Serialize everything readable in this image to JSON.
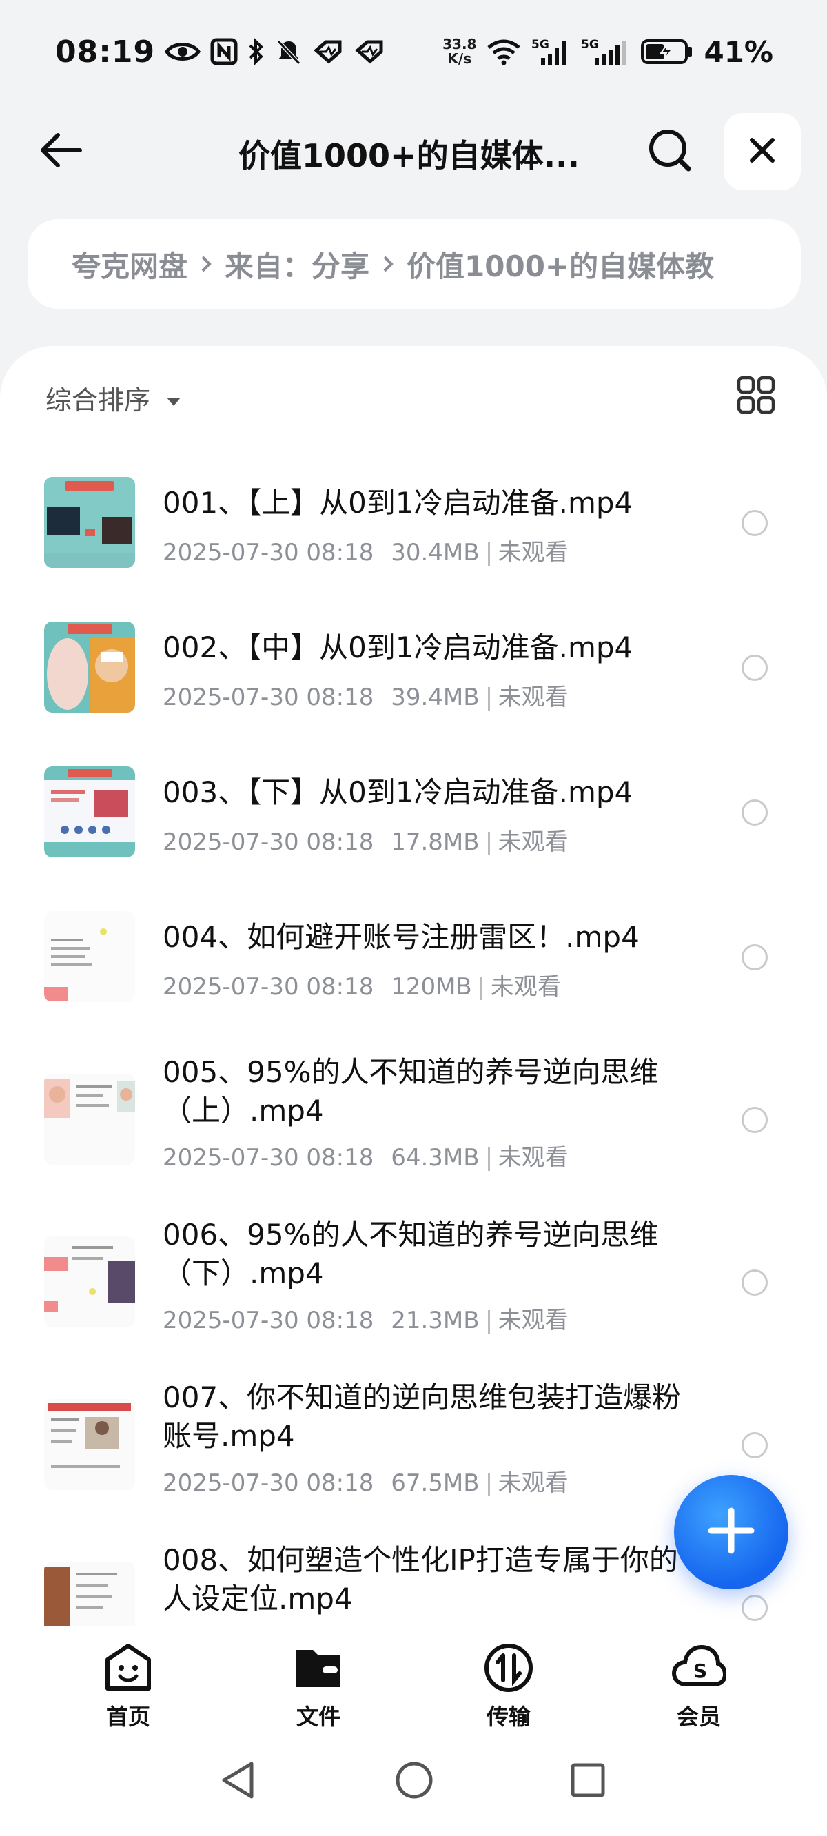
{
  "status_bar": {
    "time": "08:19",
    "net_speed_value": "33.8",
    "net_speed_unit": "K/s",
    "signal1_label": "5G",
    "signal2_label": "5G",
    "battery": "41%",
    "left_icons": [
      "eye-icon",
      "nfc-icon",
      "bluetooth-icon",
      "mute-icon",
      "heart-pulse-icon",
      "heart-pulse-icon"
    ],
    "right_icons": [
      "wifi-icon",
      "signal-icon",
      "signal-icon",
      "battery-charging-icon"
    ]
  },
  "header": {
    "title": "价值1000+的自媒体...",
    "icons": {
      "back": "back-arrow-icon",
      "search": "search-icon",
      "close": "close-icon"
    }
  },
  "breadcrumb": {
    "items": [
      "夸克网盘",
      "来自：分享",
      "价值1000+的自媒体教"
    ]
  },
  "toolbar": {
    "sort_label": "综合排序",
    "sort_icon": "caret-down-icon",
    "view_icon": "grid-view-icon"
  },
  "files": [
    {
      "name": "001、【上】从0到1冷启动准备.mp4",
      "date": "2025-07-30 08:18",
      "size": "30.4MB",
      "status": "未观看"
    },
    {
      "name": "002、【中】从0到1冷启动准备.mp4",
      "date": "2025-07-30 08:18",
      "size": "39.4MB",
      "status": "未观看"
    },
    {
      "name": "003、【下】从0到1冷启动准备.mp4",
      "date": "2025-07-30 08:18",
      "size": "17.8MB",
      "status": "未观看"
    },
    {
      "name": "004、如何避开账号注册雷区！.mp4",
      "date": "2025-07-30 08:18",
      "size": "120MB",
      "status": "未观看"
    },
    {
      "name": "005、95%的人不知道的养号逆向思维（上）.mp4",
      "date": "2025-07-30 08:18",
      "size": "64.3MB",
      "status": "未观看"
    },
    {
      "name": "006、95%的人不知道的养号逆向思维（下）.mp4",
      "date": "2025-07-30 08:18",
      "size": "21.3MB",
      "status": "未观看"
    },
    {
      "name": "007、你不知道的逆向思维包装打造爆粉账号.mp4",
      "date": "2025-07-30 08:18",
      "size": "67.5MB",
      "status": "未观看"
    },
    {
      "name": "008、如何塑造个性化IP打造专属于你的人设定位.mp4",
      "date": "",
      "size": "",
      "status": ""
    }
  ],
  "fab": {
    "icon": "plus-icon"
  },
  "tabs": [
    {
      "label": "首页",
      "icon": "home-smile-icon"
    },
    {
      "label": "文件",
      "icon": "folder-icon"
    },
    {
      "label": "传输",
      "icon": "transfer-icon"
    },
    {
      "label": "会员",
      "icon": "vip-cloud-icon"
    }
  ],
  "nav": {
    "icons": [
      "nav-back-icon",
      "nav-home-icon",
      "nav-recents-icon"
    ]
  },
  "colors": {
    "accent": "#1565ee",
    "text_primary": "#111111",
    "text_secondary": "#8d9096",
    "page_bg": "#f2f3f5"
  }
}
